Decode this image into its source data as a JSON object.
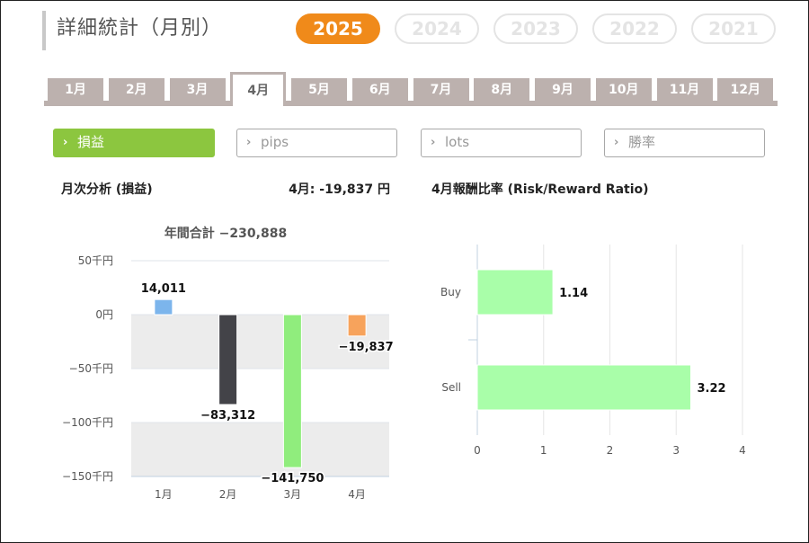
{
  "title": "詳細統計（月別）",
  "years": [
    {
      "label": "2025",
      "active": true
    },
    {
      "label": "2024",
      "active": false
    },
    {
      "label": "2023",
      "active": false
    },
    {
      "label": "2022",
      "active": false
    },
    {
      "label": "2021",
      "active": false
    }
  ],
  "months": [
    "1月",
    "2月",
    "3月",
    "4月",
    "5月",
    "6月",
    "7月",
    "8月",
    "9月",
    "10月",
    "11月",
    "12月"
  ],
  "active_month_index": 3,
  "metric_tabs": [
    {
      "label": "損益",
      "active": true
    },
    {
      "label": "pips",
      "active": false
    },
    {
      "label": "lots",
      "active": false
    },
    {
      "label": "勝率",
      "active": false
    }
  ],
  "chevron_glyph": "›",
  "left_heading": "月次分析 (損益)",
  "month_summary": "4月:  -19,837 円",
  "right_heading": "4月報酬比率 (Risk/Reward Ratio)",
  "colors": {
    "accent": "#f08a1a",
    "active_metric": "#8cc63f",
    "tab_gray": "#bcb1ae",
    "band": "#ececec"
  },
  "chart_data": [
    {
      "type": "bar",
      "title": "年間合計 −230,888",
      "categories": [
        "1月",
        "2月",
        "3月",
        "4月"
      ],
      "values": [
        14011,
        -83312,
        -141750,
        -19837
      ],
      "value_labels": [
        "14,011",
        "−83,312",
        "−141,750",
        "−19,837"
      ],
      "colors": [
        "#7cb5ec",
        "#434348",
        "#90ed7d",
        "#f7a35c"
      ],
      "yticks": [
        50000,
        0,
        -50000,
        -100000,
        -150000
      ],
      "ytick_labels": [
        "50千円",
        "0円",
        "−50千円",
        "−100千円",
        "−150千円"
      ],
      "ylim": [
        -150000,
        50000
      ],
      "bands": [
        [
          0,
          -50000
        ],
        [
          -100000,
          -150000
        ]
      ]
    },
    {
      "type": "bar",
      "orientation": "horizontal",
      "categories": [
        "Buy",
        "Sell"
      ],
      "values": [
        1.14,
        3.22
      ],
      "value_labels": [
        "1.14",
        "3.22"
      ],
      "color": "#a9fea9",
      "xticks": [
        0,
        1,
        2,
        3,
        4
      ],
      "xlim": [
        0,
        4
      ],
      "grid": true
    }
  ]
}
